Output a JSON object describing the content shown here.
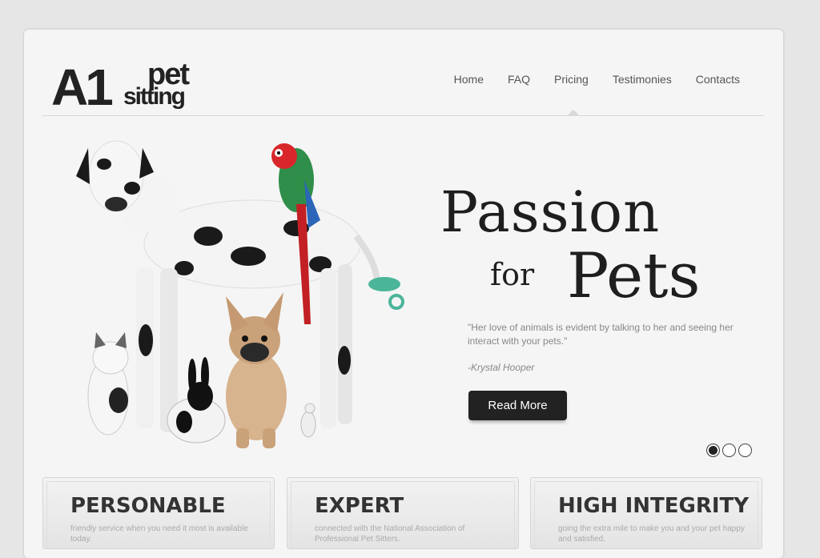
{
  "logo": {
    "a1": "A1",
    "pet": "pet",
    "sitting": "sitting"
  },
  "nav": {
    "items": [
      "Home",
      "FAQ",
      "Pricing",
      "Testimonies",
      "Contacts"
    ],
    "active": "Pricing"
  },
  "hero": {
    "headline_line1": "Passion",
    "headline_for": "for",
    "headline_line2": "Pets",
    "quote": "\"Her love of animals is evident by talking to her and seeing her interact with your pets.\"",
    "author": "-Krystal Hooper",
    "button_label": "Read More",
    "slides": {
      "count": 3,
      "active": 1
    },
    "image_icon": "pets-group-photo"
  },
  "features": [
    {
      "title": "PERSONABLE",
      "text": "friendly service when you need it most is available today."
    },
    {
      "title": "EXPERT",
      "text": "connected with the National Association of Professional Pet Sitters."
    },
    {
      "title": "HIGH INTEGRITY",
      "text": "going the extra mile to make you and your pet happy and satisfied."
    }
  ],
  "colors": {
    "background": "#e6e6e6",
    "card": "#f5f5f5",
    "text_dark": "#1e1e1e",
    "button": "#222222"
  }
}
